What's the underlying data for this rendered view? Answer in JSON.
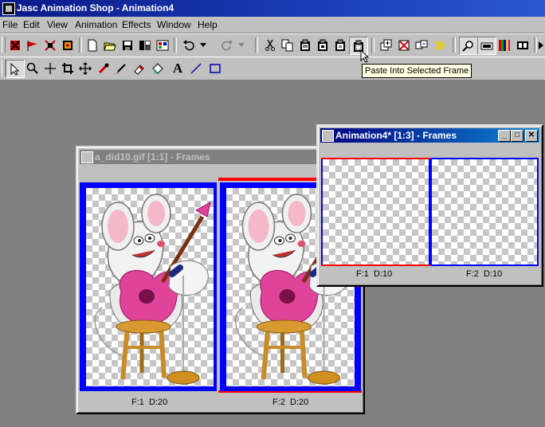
{
  "app": {
    "title": "Jasc Animation Shop - Animation4"
  },
  "menu": [
    "File",
    "Edit",
    "View",
    "Animation",
    "Effects",
    "Window",
    "Help"
  ],
  "toolbar_main": [
    "animation-wizard-icon",
    "banner-wizard-icon",
    "optimization-wizard-icon",
    "sound-wizard-icon",
    "new-file-icon",
    "open-file-icon",
    "save-icon",
    "save-as-icon",
    "browse-icon",
    "undo-icon",
    "undo-dropdown-icon",
    "redo-icon",
    "redo-dropdown-icon",
    "cut-icon",
    "copy-icon",
    "paste-as-new-animation-icon",
    "paste-as-new-frame-icon",
    "paste-into-frame-icon",
    "paste-into-selected-frame-icon",
    "insert-frames-icon",
    "delete-frames-icon",
    "frame-properties-icon",
    "view-animation-icon",
    "zoom-icon",
    "frame-counter-icon",
    "color-palette-icon",
    "film-strip-icon"
  ],
  "toolbar_tools": [
    "arrow-tool-icon",
    "zoom-tool-icon",
    "crosshair-tool-icon",
    "crop-tool-icon",
    "move-tool-icon",
    "dropper-tool-icon",
    "paintbrush-tool-icon",
    "eraser-tool-icon",
    "fill-tool-icon",
    "text-tool-icon",
    "line-tool-icon",
    "rectangle-tool-icon"
  ],
  "tooltip": "Paste Into Selected Frame",
  "window_did": {
    "title": "a_did10.gif [1:1] - Frames",
    "frames": [
      {
        "label": "F:1  D:20"
      },
      {
        "label": "F:2  D:20"
      }
    ]
  },
  "window_anim": {
    "title": "Animation4* [1:3] - Frames",
    "frames": [
      {
        "label": "F:1  D:10"
      },
      {
        "label": "F:2  D:10"
      }
    ]
  },
  "colors": {
    "selection": "#0000ff",
    "marker": "#ff0000",
    "guitar": "#e0449a",
    "stool": "#c88c28"
  }
}
